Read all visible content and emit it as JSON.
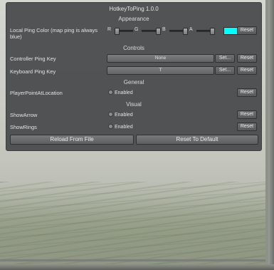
{
  "window": {
    "title": "HotkeyToPing 1.0.0"
  },
  "sections": {
    "appearance": "Appearance",
    "controls": "Controls",
    "general": "General",
    "visual": "Visual"
  },
  "appearance": {
    "local_ping_color_label": "Local Ping Color (map ping is always blue)",
    "sliders": [
      {
        "letter": "R",
        "value": 0.0
      },
      {
        "letter": "G",
        "value": 1.0
      },
      {
        "letter": "B",
        "value": 1.0
      },
      {
        "letter": "A",
        "value": 1.0
      }
    ],
    "color_hex": "#00ffff",
    "reset_label": "Reset"
  },
  "controls": {
    "controller_ping_key": {
      "label": "Controller Ping Key",
      "value": "None",
      "set_label": "Set...",
      "reset_label": "Reset"
    },
    "keyboard_ping_key": {
      "label": "Keyboard Ping Key",
      "value": "T",
      "set_label": "Set...",
      "reset_label": "Reset"
    }
  },
  "general": {
    "player_point_at_location": {
      "label": "PlayerPointAtLocation",
      "toggle_label": "Enabled",
      "reset_label": "Reset"
    }
  },
  "visual": {
    "show_arrow": {
      "label": "ShowArrow",
      "toggle_label": "Enabled",
      "reset_label": "Reset"
    },
    "show_rings": {
      "label": "ShowRings",
      "toggle_label": "Enabled",
      "reset_label": "Reset"
    }
  },
  "footer": {
    "reload_label": "Reload From File",
    "reset_default_label": "Reset To Default"
  },
  "colors": {
    "panel_bg": "#46484a",
    "swatch": "#00ffff"
  }
}
